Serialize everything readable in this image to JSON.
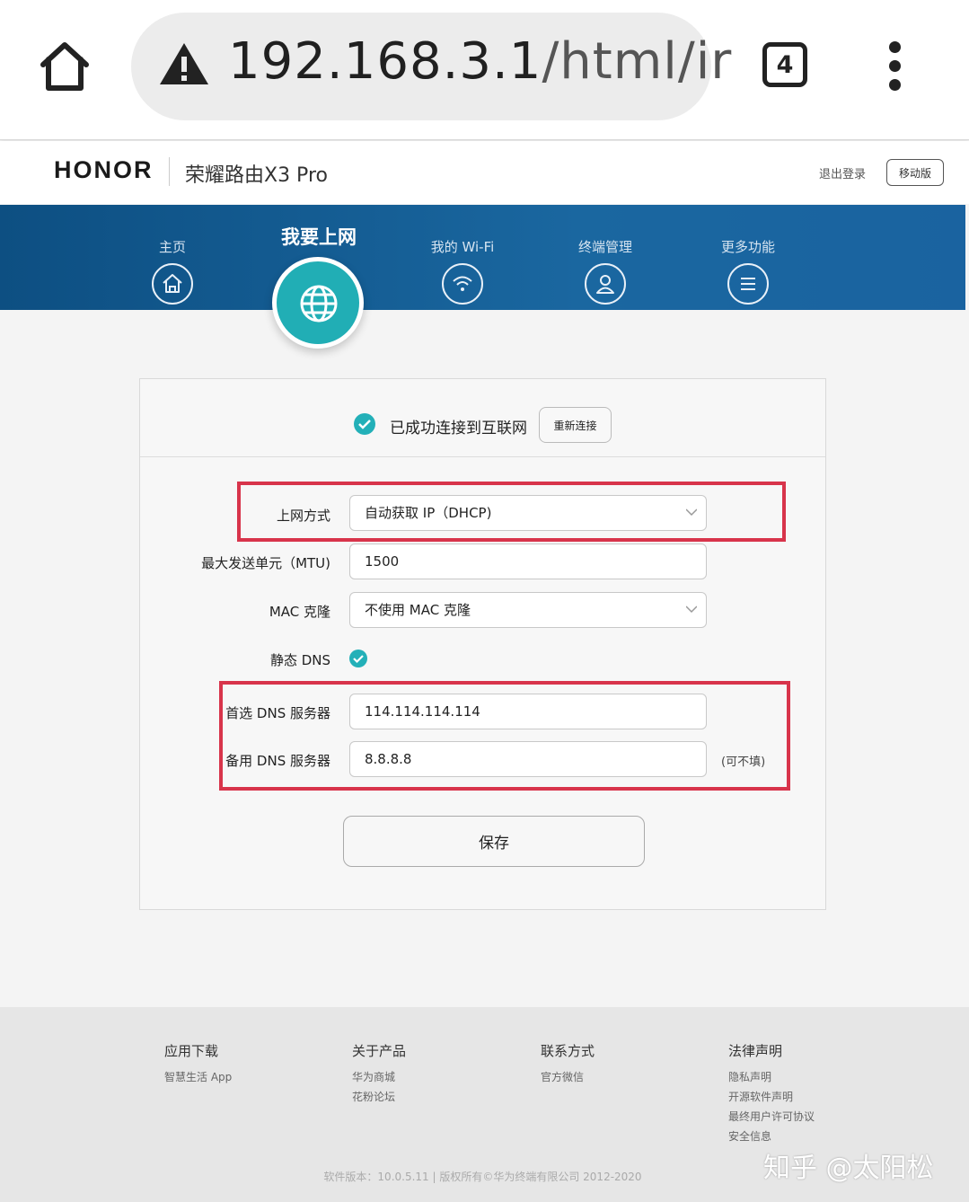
{
  "browser": {
    "url_host": "192.168.3.1",
    "url_path": "/html/ir",
    "tab_count": "4"
  },
  "header": {
    "brand": "HONOR",
    "product": "荣耀路由X3 Pro",
    "logout": "退出登录",
    "mobile_version": "移动版"
  },
  "nav": {
    "items": [
      {
        "label": "主页",
        "icon": "home-icon"
      },
      {
        "label": "我要上网",
        "icon": "globe-icon",
        "active": true
      },
      {
        "label": "我的 Wi-Fi",
        "icon": "wifi-icon"
      },
      {
        "label": "终端管理",
        "icon": "user-icon"
      },
      {
        "label": "更多功能",
        "icon": "menu-icon"
      }
    ]
  },
  "status": {
    "text": "已成功连接到互联网",
    "reconnect": "重新连接"
  },
  "form": {
    "connection_type_label": "上网方式",
    "connection_type_value": "自动获取 IP（DHCP)",
    "mtu_label": "最大发送单元（MTU)",
    "mtu_value": "1500",
    "mac_clone_label": "MAC 克隆",
    "mac_clone_value": "不使用 MAC 克隆",
    "static_dns_label": "静态 DNS",
    "static_dns_checked": true,
    "primary_dns_label": "首选 DNS 服务器",
    "primary_dns_value": "114.114.114.114",
    "secondary_dns_label": "备用 DNS 服务器",
    "secondary_dns_value": "8.8.8.8",
    "optional_note": "(可不填)",
    "save": "保存"
  },
  "footer": {
    "columns": [
      {
        "heading": "应用下载",
        "links": [
          "智慧生活 App"
        ]
      },
      {
        "heading": "关于产品",
        "links": [
          "华为商城",
          "花粉论坛"
        ]
      },
      {
        "heading": "联系方式",
        "links": [
          "官方微信"
        ]
      },
      {
        "heading": "法律声明",
        "links": [
          "隐私声明",
          "开源软件声明",
          "最终用户许可协议",
          "安全信息"
        ]
      }
    ],
    "copyright": "软件版本：10.0.5.11 |  版权所有©华为终端有限公司 2012-2020",
    "watermark": "知乎 @太阳松"
  },
  "colors": {
    "accent_teal": "#23b0b8",
    "nav_blue": "#1a67a0",
    "highlight_red": "#d8344b"
  }
}
